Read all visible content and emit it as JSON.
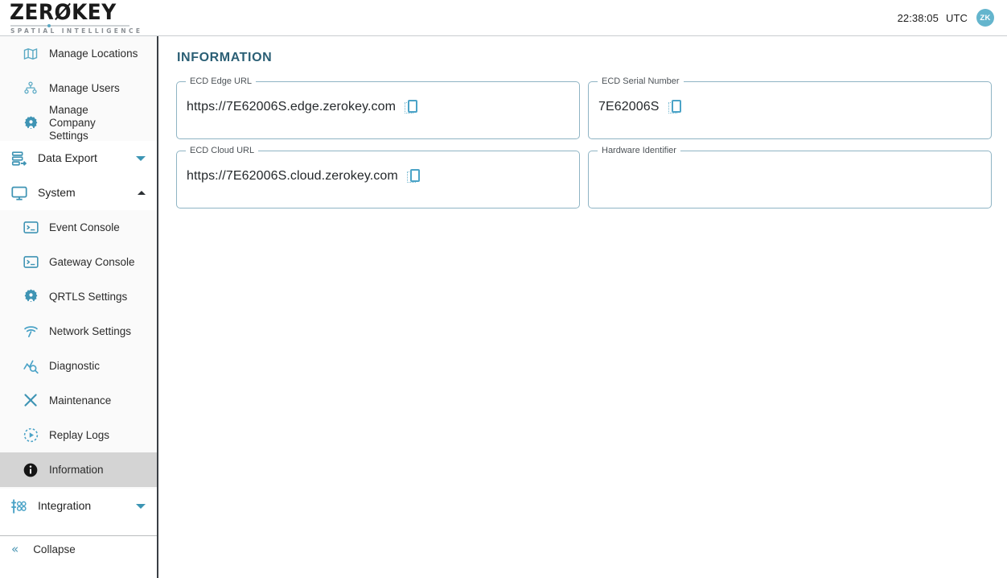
{
  "header": {
    "logo_main": "ZERØKEY",
    "logo_sub": "SPATIAL INTELLIGENCE",
    "time": "22:38:05",
    "timezone": "UTC",
    "avatar_initials": "ZK"
  },
  "sidebar": {
    "top_items": [
      {
        "label": "Manage Locations",
        "icon": "map-icon"
      },
      {
        "label": "Manage Users",
        "icon": "users-icon"
      },
      {
        "label": "Manage Company Settings",
        "icon": "company-gear-icon"
      }
    ],
    "groups": [
      {
        "label": "Data Export",
        "icon": "export-icon",
        "chevron": "chevron-down-icon",
        "expanded": false
      },
      {
        "label": "System",
        "icon": "monitor-icon",
        "chevron": "chevron-up-icon",
        "expanded": true
      }
    ],
    "system_items": [
      {
        "label": "Event Console",
        "icon": "terminal-icon",
        "selected": false
      },
      {
        "label": "Gateway Console",
        "icon": "terminal-icon",
        "selected": false
      },
      {
        "label": "QRTLS Settings",
        "icon": "gear-icon",
        "selected": false
      },
      {
        "label": "Network Settings",
        "icon": "wifi-icon",
        "selected": false
      },
      {
        "label": "Diagnostic",
        "icon": "diagnostic-icon",
        "selected": false
      },
      {
        "label": "Maintenance",
        "icon": "tools-icon",
        "selected": false
      },
      {
        "label": "Replay Logs",
        "icon": "replay-icon",
        "selected": false
      },
      {
        "label": "Information",
        "icon": "info-icon",
        "selected": true
      }
    ],
    "integration": {
      "label": "Integration",
      "icon": "integration-icon",
      "chevron": "chevron-down-icon"
    },
    "collapse": {
      "label": "Collapse",
      "icon": "double-chevron-left-icon"
    }
  },
  "main": {
    "page_title": "INFORMATION",
    "fields": [
      {
        "legend": "ECD Edge URL",
        "value": "https://7E62006S.edge.zerokey.com",
        "has_copy": true
      },
      {
        "legend": "ECD Serial Number",
        "value": "7E62006S",
        "has_copy": true
      },
      {
        "legend": "ECD Cloud URL",
        "value": "https://7E62006S.cloud.zerokey.com",
        "has_copy": true
      },
      {
        "legend": "Hardware Identifier",
        "value": "",
        "has_copy": false
      }
    ]
  },
  "colors": {
    "accent_teal": "#4ba3c7",
    "title_blue": "#2b5f75",
    "field_border": "#8fb4c4",
    "selected_bg": "#d4d4d4",
    "avatar_bg": "#64b5cd"
  }
}
